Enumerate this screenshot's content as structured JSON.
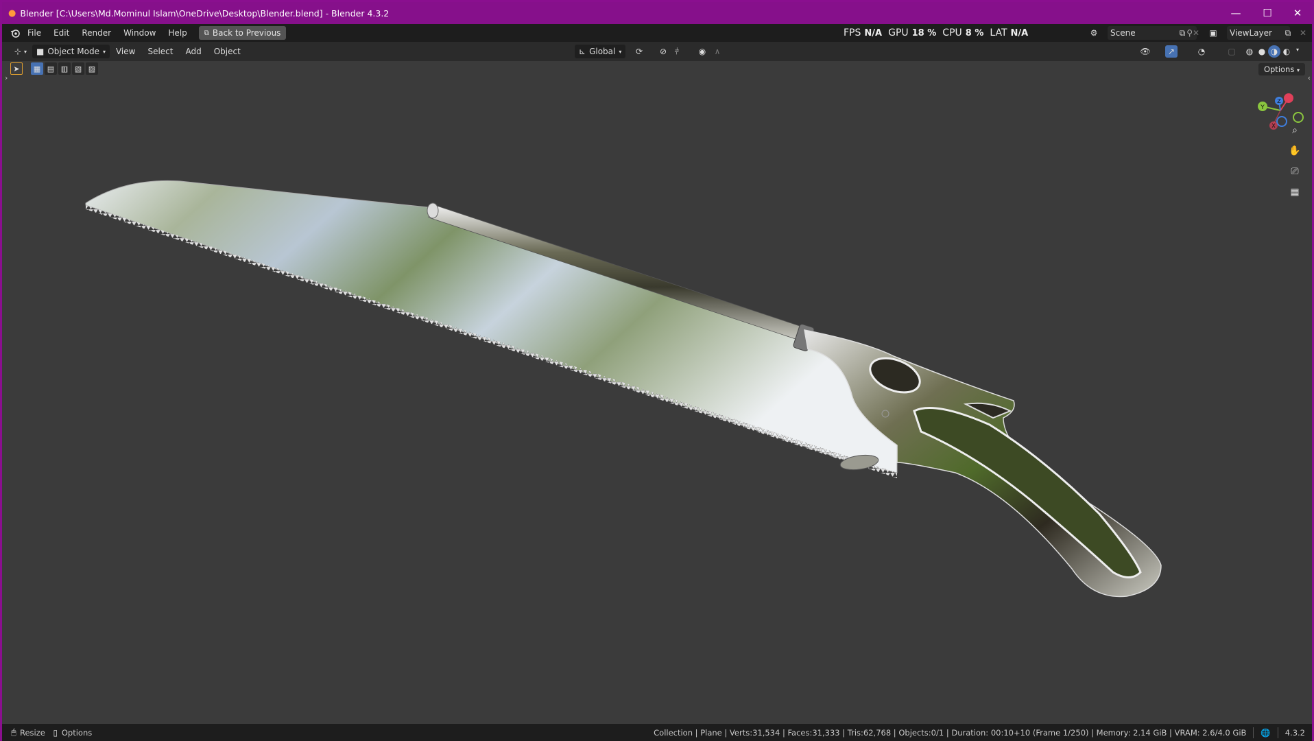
{
  "window": {
    "title": "Blender [C:\\Users\\Md.Mominul Islam\\OneDrive\\Desktop\\Blender.blend] - Blender 4.3.2",
    "min": "—",
    "max": "☐",
    "close": "✕"
  },
  "menubar": {
    "items": [
      "File",
      "Edit",
      "Render",
      "Window",
      "Help"
    ],
    "back_button": "Back to Previous"
  },
  "stats": {
    "fps_label": "FPS",
    "fps_value": "N/A",
    "gpu_label": "GPU",
    "gpu_value": "18 %",
    "cpu_label": "CPU",
    "cpu_value": "8 %",
    "lat_label": "LAT",
    "lat_value": "N/A"
  },
  "scene": {
    "name": "Scene"
  },
  "view_layer": {
    "name": "ViewLayer"
  },
  "viewport_header": {
    "mode": "Object Mode",
    "menus": [
      "View",
      "Select",
      "Add",
      "Object"
    ],
    "transform_orientation": "Global",
    "options": "Options"
  },
  "gizmo": {
    "x": "X",
    "y": "Y",
    "z": "Z"
  },
  "statusbar": {
    "left": [
      "Resize",
      "Options"
    ],
    "info": "Collection | Plane | Verts:31,534 | Faces:31,333 | Tris:62,768 | Objects:0/1 | Duration: 00:10+10 (Frame 1/250) | Memory: 2.14 GiB | VRAM: 2.6/4.0 GiB",
    "version": "4.3.2"
  },
  "colors": {
    "title_bar": "#86108b",
    "accent_blue": "#4772b3",
    "axis_x": "#e0405a",
    "axis_y": "#8bc63f",
    "axis_z": "#3f7fdf"
  }
}
